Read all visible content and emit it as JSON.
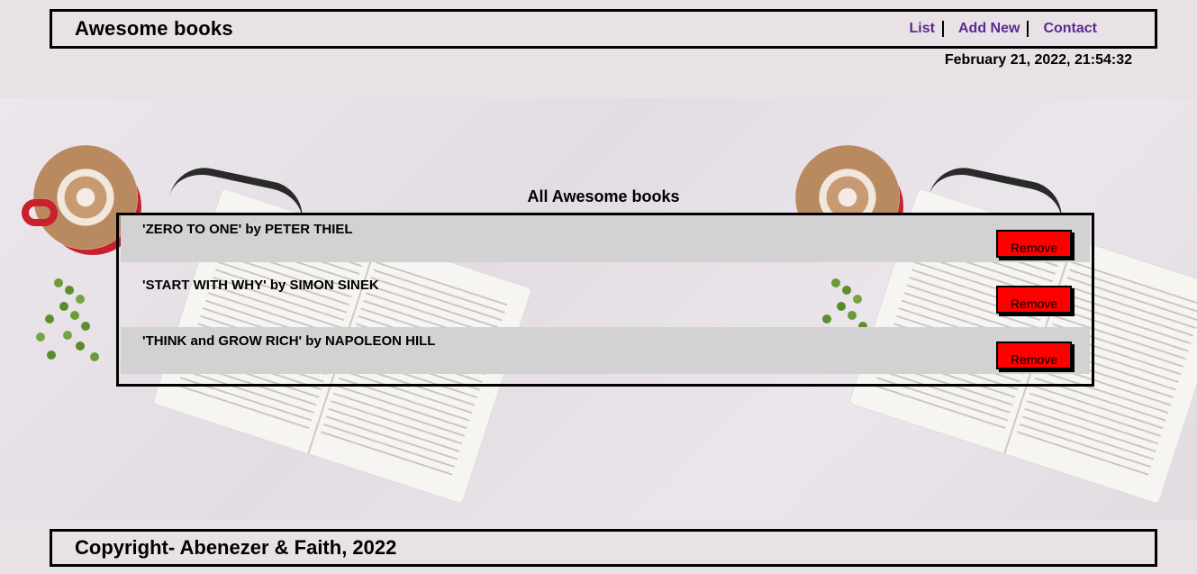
{
  "header": {
    "brand": "Awesome books",
    "nav": [
      "List",
      "Add New",
      "Contact"
    ],
    "link_color": "#5b2a8e"
  },
  "datetime": "February 21, 2022, 21:54:32",
  "main": {
    "title": "All Awesome books",
    "books": [
      {
        "text": "'ZERO TO ONE' by PETER THIEL",
        "remove_label": "Remove"
      },
      {
        "text": "'START WITH WHY' by SIMON SINEK",
        "remove_label": "Remove"
      },
      {
        "text": "'THINK and GROW RICH' by NAPOLEON HILL",
        "remove_label": "Remove"
      }
    ],
    "row_color": "#d2d2d2",
    "remove_color": "#ff0000"
  },
  "footer": {
    "text": "Copyright- Abenezer & Faith, 2022"
  }
}
